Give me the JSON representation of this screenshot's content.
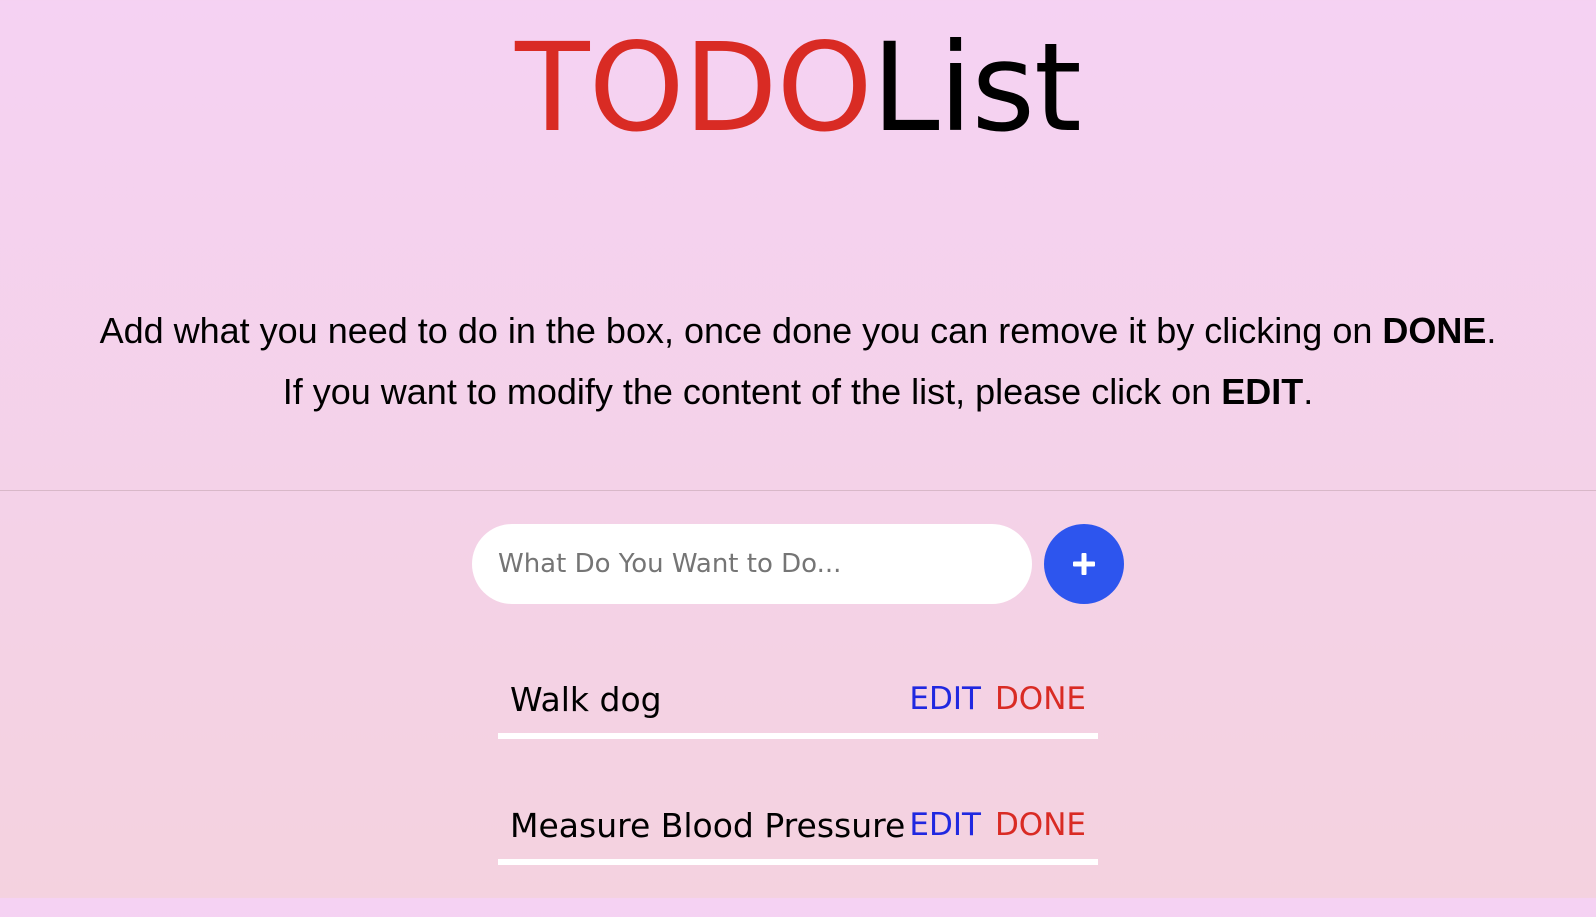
{
  "header": {
    "title_part1": "TODO",
    "title_part2": "List",
    "accent_color": "#d92b24"
  },
  "instructions": {
    "line1_prefix": "Add what you need to do in the box, once done you can remove it by clicking on ",
    "line1_bold": "DONE",
    "line1_suffix": ".",
    "line2_prefix": "If you want to modify the content of the list, please click on ",
    "line2_bold": "EDIT",
    "line2_suffix": "."
  },
  "form": {
    "placeholder": "What Do You Want to Do...",
    "value": "",
    "add_icon": "plus-icon",
    "add_button_color": "#2d55ee"
  },
  "todos": [
    {
      "text": "Walk dog",
      "edit_label": "EDIT",
      "done_label": "DONE"
    },
    {
      "text": "Measure Blood Pressure",
      "edit_label": "EDIT",
      "done_label": "DONE"
    }
  ],
  "colors": {
    "edit": "#2028e0",
    "done": "#d92b24",
    "background_top": "#f5d2f3",
    "background_bottom": "#f4d2df"
  }
}
